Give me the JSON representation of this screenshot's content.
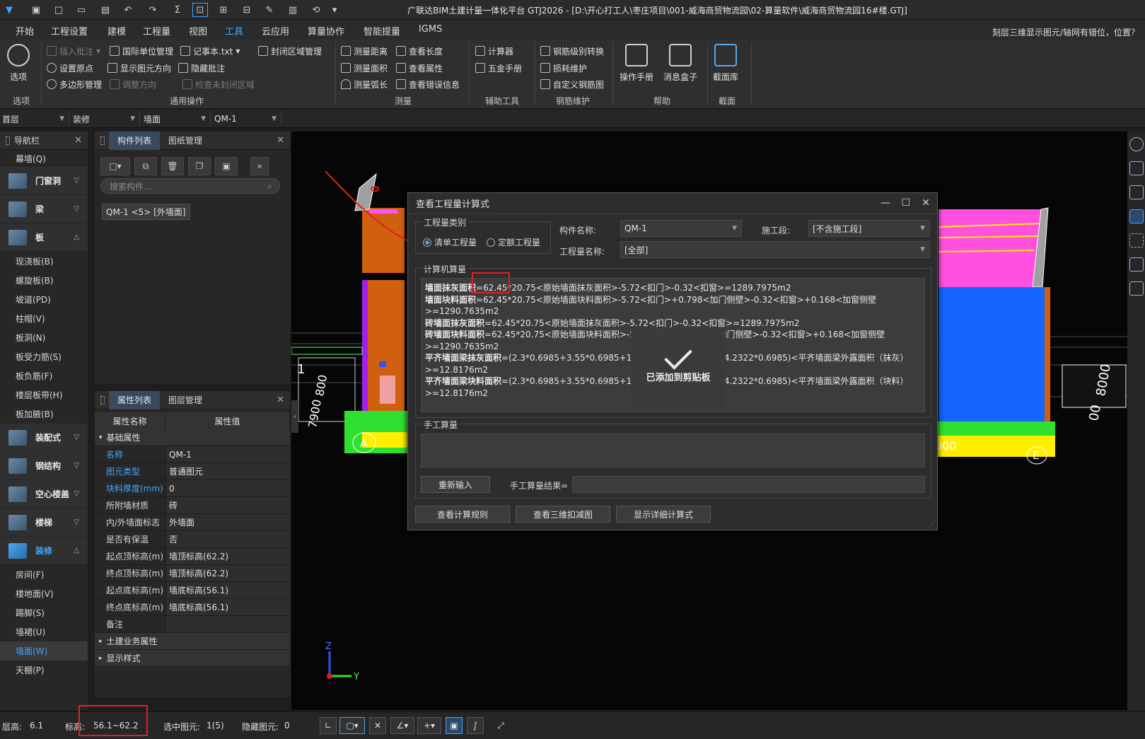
{
  "titlebar": {
    "title": "广联达BIM土建计量一体化平台 GTJ2026 - [D:\\开心打工人\\枣庄项目\\001-威海商贸物流园\\02-算量软件\\威海商贸物流园16#楼.GTJ]"
  },
  "menu": {
    "items": [
      "开始",
      "工程设置",
      "建模",
      "工程量",
      "视图",
      "工具",
      "云应用",
      "算量协作",
      "智能提量",
      "IGMS"
    ],
    "active_index": 5,
    "right_text": "刻层三维显示图元/轴网有错位，位置？"
  },
  "ribbon": {
    "options_label": "选项",
    "options_group": "选项",
    "general": {
      "insert_note": "插入批注",
      "intl_unit": "国际单位管理",
      "notepad": "记事本.txt",
      "set_origin": "设置原点",
      "show_dir": "显示图元方向",
      "hide_note": "隐藏批注",
      "poly_mgr": "多边形管理",
      "adjust_dir": "调整方向",
      "check_closed": "检查未封闭区域",
      "closed_area": "封闭区域管理",
      "group": "通用操作"
    },
    "measure": {
      "dist": "测量距离",
      "area": "测量面积",
      "arc": "测量弧长",
      "length": "查看长度",
      "attr": "查看属性",
      "err": "查看错误信息",
      "group": "测量"
    },
    "aux": {
      "calc": "计算器",
      "hardware": "五金手册",
      "group": "辅助工具"
    },
    "rebar": {
      "grade": "钢筋级别转换",
      "loss": "损耗维护",
      "custom": "自定义钢筋图",
      "group": "钢筋维护"
    },
    "help": {
      "manual": "操作手册",
      "msgbox": "消息盒子",
      "group": "帮助"
    },
    "section": {
      "lib": "截面库",
      "group": "截面"
    }
  },
  "selectors": [
    "首层",
    "装修",
    "墙面",
    "QM-1"
  ],
  "nav": {
    "title": "导航栏",
    "top_item": "幕墙(Q)",
    "cat_door": "门窗洞",
    "cat_beam": "梁",
    "cat_slab": "板",
    "slab_items": [
      "现浇板(B)",
      "螺旋板(B)",
      "坡道(PD)",
      "柱帽(V)",
      "板洞(N)",
      "板受力筋(S)",
      "板负筋(F)",
      "楼层板带(H)",
      "板加腋(B)"
    ],
    "cat_prefab": "装配式",
    "cat_steel": "钢结构",
    "cat_hollow": "空心楼盖",
    "cat_stair": "楼梯",
    "cat_decor": "装修",
    "decor_items": [
      "房间(F)",
      "楼地面(V)",
      "踢脚(S)",
      "墙裙(U)",
      "墙面(W)",
      "天棚(P)"
    ]
  },
  "comp": {
    "tab1": "构件列表",
    "tab2": "图纸管理",
    "search_placeholder": "搜索构件...",
    "item": "QM-1 <5> [外墙面]"
  },
  "props": {
    "tab1": "属性列表",
    "tab2": "图层管理",
    "col_name": "属性名称",
    "col_val": "属性值",
    "group_basic": "基础属性",
    "rows": [
      {
        "n": "名称",
        "v": "QM-1"
      },
      {
        "n": "图元类型",
        "v": "普通图元"
      },
      {
        "n": "块料厚度(mm)",
        "v": "0"
      },
      {
        "n": "所附墙材质",
        "v": "砖"
      },
      {
        "n": "内/外墙面标志",
        "v": "外墙面"
      },
      {
        "n": "是否有保温",
        "v": "否"
      },
      {
        "n": "起点顶标高(m)",
        "v": "墙顶标高(62.2)"
      },
      {
        "n": "终点顶标高(m)",
        "v": "墙顶标高(62.2)"
      },
      {
        "n": "起点底标高(m)",
        "v": "墙底标高(56.1)"
      },
      {
        "n": "终点底标高(m)",
        "v": "墙底标高(56.1)"
      },
      {
        "n": "备注",
        "v": ""
      }
    ],
    "group_civil": "土建业务属性",
    "group_display": "显示样式"
  },
  "viewport": {
    "axis_z": "Z",
    "axis_y": "Y",
    "left_nums": [
      "1",
      "800",
      "7900"
    ],
    "right_nums": [
      "8000",
      "00",
      "000"
    ],
    "grid_a": "A",
    "grid_e": "E"
  },
  "dialog": {
    "title": "查看工程量计算式",
    "qty_type_label": "工程量类别",
    "radio1": "清单工程量",
    "radio2": "定额工程量",
    "comp_name_label": "构件名称:",
    "comp_name": "QM-1",
    "stage_label": "施工段:",
    "stage": "[不含施工段]",
    "qty_name_label": "工程量名称:",
    "qty_name": "[全部]",
    "computer_label": "计算机算量",
    "lines": [
      {
        "k": "墙面抹灰面积",
        "v": "=62.45*20.75<原始墙面抹灰面积>-5.72<扣门>-0.32<扣窗>=1289.7975m2"
      },
      {
        "k": "墙面块料面积",
        "v": "=62.45*20.75<原始墙面块料面积>-5.72<扣门>+0.798<加门侧壁>-0.32<扣窗>+0.168<加窗侧壁>=1290.7635m2"
      },
      {
        "k": "砖墙面抹灰面积",
        "v": "=62.45*20.75<原始墙面抹灰面积>-5.72<扣门>-0.32<扣窗>=1289.7975m2"
      },
      {
        "k": "砖墙面块料面积",
        "v": "=62.45*20.75<原始墙面块料面积>-5.72<扣门>+0.798<加门侧壁>-0.32<扣窗>+0.168<加窗侧壁>=1290.7635m2"
      },
      {
        "k": "平齐墙面梁抹灰面积",
        "v": "=(2.3*0.6985+3.55*0.6985+1.675... 9928*0.6985+4.2322*0.6985)<平齐墙面梁外露面积（抹灰）>=12.8176m2"
      },
      {
        "k": "平齐墙面梁块料面积",
        "v": "=(2.3*0.6985+3.55*0.6985+1.675... 9928*0.6985+4.2322*0.6985)<平齐墙面梁外露面积（块料）>=12.8176m2"
      }
    ],
    "toast": "已添加到剪贴板",
    "manual_label": "手工算量",
    "reinput": "重新输入",
    "manual_result_label": "手工算量结果=",
    "btn_rules": "查看计算规则",
    "btn_3d": "查看三维扣减图",
    "btn_detail": "显示详细计算式"
  },
  "status": {
    "floor_h_label": "层高:",
    "floor_h": "6.1",
    "elev_label": "标高:",
    "elev": "56.1~62.2",
    "selected_label": "选中图元:",
    "selected": "1(5)",
    "hidden_label": "隐藏图元:",
    "hidden": "0"
  }
}
